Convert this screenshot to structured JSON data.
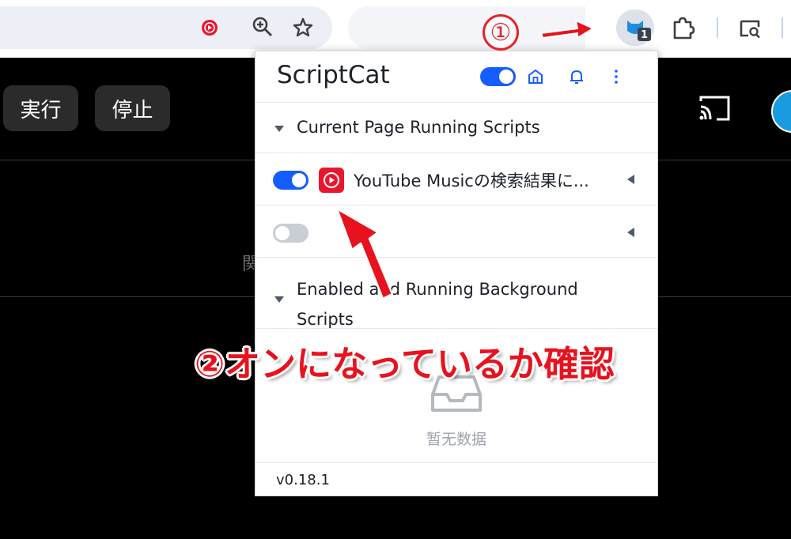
{
  "toolbar": {
    "extension_badge": "1"
  },
  "page": {
    "run_button": "実行",
    "stop_button": "停止",
    "partial_char": "関"
  },
  "popup": {
    "title": "ScriptCat",
    "enabled": true,
    "section_current": "Current Page Running Scripts",
    "scripts": [
      {
        "name": "YouTube Musicの検索結果に...",
        "enabled": true
      },
      {
        "name": "",
        "enabled": false
      }
    ],
    "section_background": "Enabled and Running Background Scripts",
    "empty_text": "暂无数据",
    "version": "v0.18.1"
  },
  "annotations": {
    "step1": "①",
    "step2": "②オンになっているか確認"
  },
  "colors": {
    "accent": "#165dff",
    "annotation": "#e8121e",
    "youtube_red": "#e9172e"
  }
}
